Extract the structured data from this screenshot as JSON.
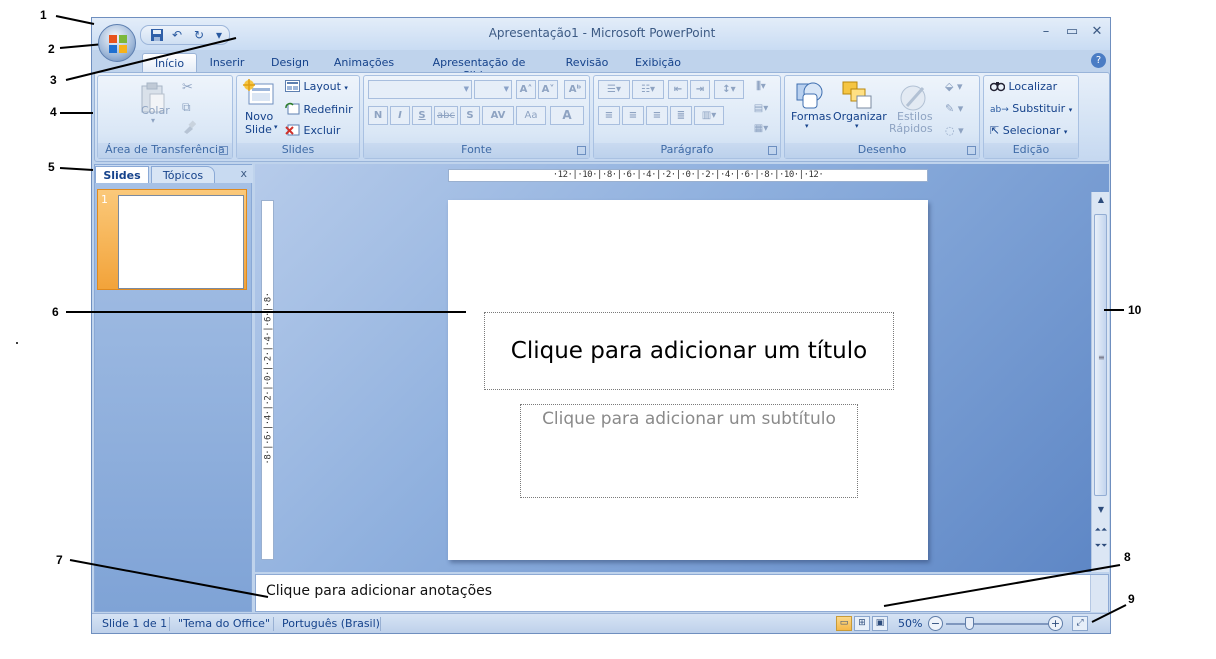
{
  "window": {
    "title": "Apresentação1 - Microsoft PowerPoint",
    "minimize": "–",
    "maximize": "▭",
    "close": "✕"
  },
  "qat": {
    "save": "save-icon",
    "undo": "↶",
    "redo": "↻",
    "more": "▾"
  },
  "tabs": [
    "Início",
    "Inserir",
    "Design",
    "Animações",
    "Apresentação de Slides",
    "Revisão",
    "Exibição"
  ],
  "help": "?",
  "ribbon": {
    "clipboard": {
      "label": "Área de Transferência",
      "paste": "Colar",
      "cut": "✂",
      "copy": "⧉",
      "format_painter": "🖌"
    },
    "slides": {
      "label": "Slides",
      "new_slide_1": "Novo",
      "new_slide_2": "Slide",
      "layout": "Layout",
      "reset": "Redefinir",
      "delete": "Excluir"
    },
    "font": {
      "label": "Fonte",
      "grow": "A˄",
      "shrink": "A˅",
      "clear": "Aᵇ",
      "bold": "N",
      "italic": "I",
      "underline": "S",
      "strike": "abc",
      "shadow": "S",
      "spacing": "AV",
      "case": "Aa",
      "color": "A"
    },
    "paragraph": {
      "label": "Parágrafo"
    },
    "drawing": {
      "label": "Desenho",
      "shapes": "Formas",
      "arrange": "Organizar",
      "styles_1": "Estilos",
      "styles_2": "Rápidos"
    },
    "editing": {
      "label": "Edição",
      "find": "Localizar",
      "replace": "Substituir",
      "select": "Selecionar"
    }
  },
  "pane": {
    "tab_slides": "Slides",
    "tab_topics": "Tópicos",
    "close": "x",
    "slide_number": "1"
  },
  "ruler": {
    "horizontal": "·12·|·10·|·8·|·6·|·4·|·2·|·0·|·2·|·4·|·6·|·8·|·10·|·12·",
    "vertical": "·8·|·6·|·4·|·2·|·0·|·2·|·4·|·6·|·8·"
  },
  "slide": {
    "title_placeholder": "Clique para adicionar um título",
    "subtitle_placeholder": "Clique para adicionar um subtítulo"
  },
  "notes": {
    "placeholder": "Clique para adicionar anotações"
  },
  "status": {
    "slide": "Slide 1 de 1",
    "theme": "\"Tema do Office\"",
    "language": "Português (Brasil)",
    "zoom": "50%",
    "zoom_out": "−",
    "zoom_in": "+",
    "zoom_level": 0.5
  },
  "callouts": [
    "1",
    "2",
    "3",
    "4",
    "5",
    "6",
    "7",
    "8",
    "9",
    "10"
  ],
  "colors": {
    "accent": "#15428b",
    "ribbon": "#d3e2f4",
    "selected_thumb": "#f2a33a"
  }
}
